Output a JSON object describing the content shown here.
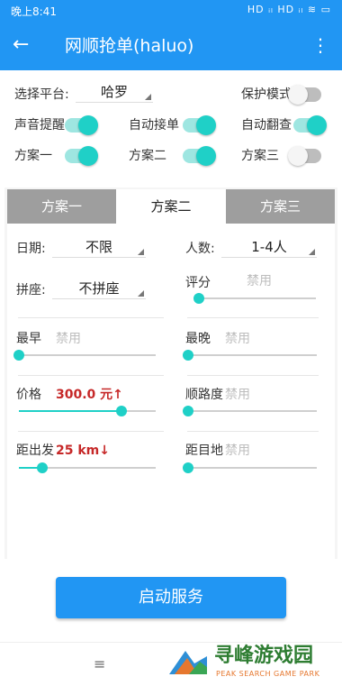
{
  "status": {
    "time": "晚上8:41",
    "icons": "HD ᵢₗ HD ᵢₗ ≋ ▭"
  },
  "appbar": {
    "back_glyph": "←",
    "title": "网顺抢单(haluo)",
    "menu_glyph": "⋮"
  },
  "top": {
    "platform_label": "选择平台:",
    "platform_value": "哈罗",
    "protect_label": "保护模式",
    "protect_on": false,
    "sound_label": "声音提醒",
    "sound_on": true,
    "auto_accept_label": "自动接单",
    "auto_accept_on": true,
    "auto_flip_label": "自动翻查",
    "auto_flip_on": true,
    "plan1_label": "方案一",
    "plan1_on": true,
    "plan2_label": "方案二",
    "plan2_on": true,
    "plan3_label": "方案三",
    "plan3_on": false
  },
  "tabs": [
    "方案一",
    "方案二",
    "方案三"
  ],
  "active_tab": 1,
  "panel": {
    "date_label": "日期:",
    "date_value": "不限",
    "people_label": "人数:",
    "people_value": "1-4人",
    "carpool_label": "拼座:",
    "carpool_value": "不拼座",
    "rating_label": "评分",
    "rating_value": "禁用",
    "rating_level": 0,
    "earliest_label": "最早",
    "earliest_value": "禁用",
    "earliest_level": 0,
    "latest_label": "最晚",
    "latest_value": "禁用",
    "latest_level": 0,
    "price_label": "价格",
    "price_value": "300.0 元↑",
    "price_level": 0.75,
    "route_label": "顺路度",
    "route_value": "禁用",
    "route_level": 0,
    "distance_label": "距出发",
    "distance_value": "25 km↓",
    "distance_level": 0.17,
    "dest_label": "距目地",
    "dest_value": "禁用",
    "dest_level": 0
  },
  "start_button": "启动服务",
  "navbar": {
    "menu_glyph": "≡"
  },
  "watermark": {
    "title": "寻峰游戏园",
    "subtitle": "PEAK SEARCH GAME PARK"
  }
}
